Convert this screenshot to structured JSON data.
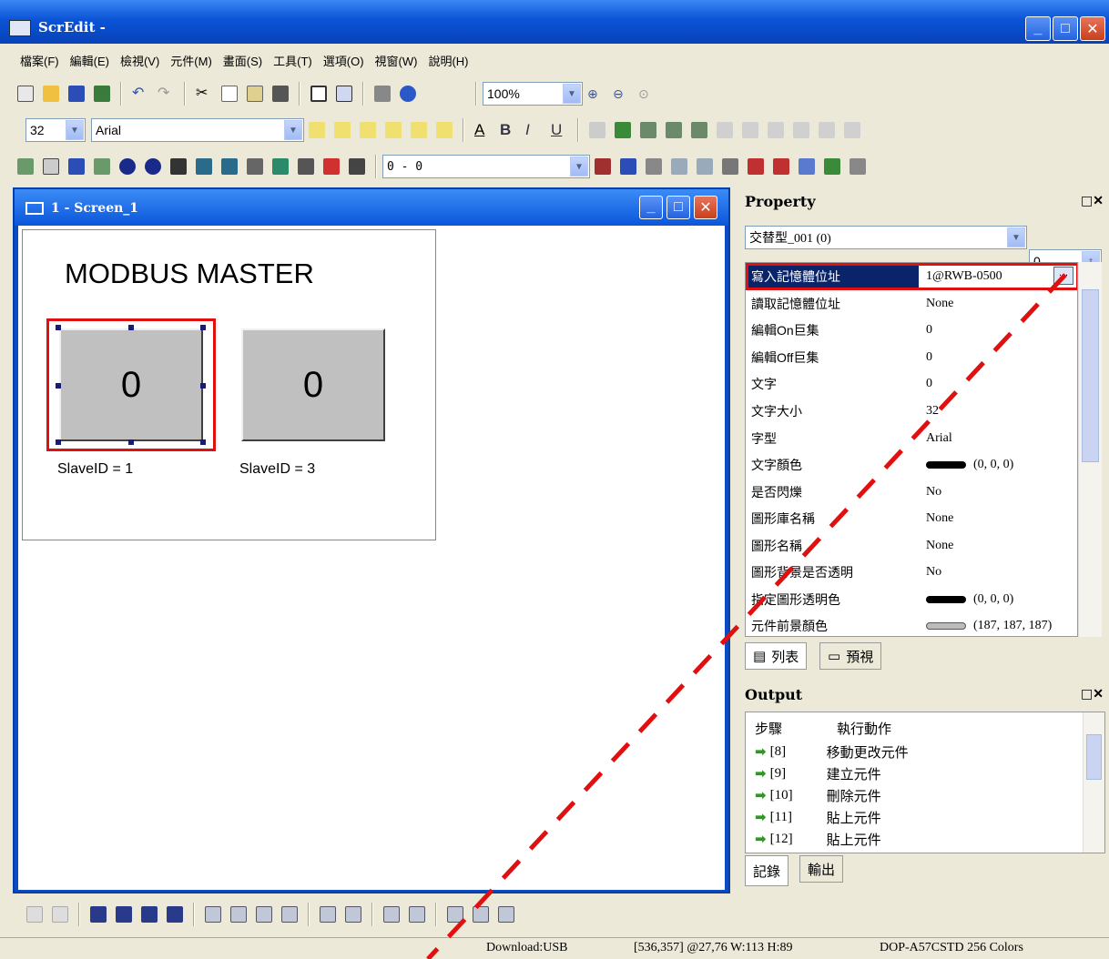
{
  "window": {
    "title": "ScrEdit -"
  },
  "menu": [
    "檔案(F)",
    "編輯(E)",
    "檢視(V)",
    "元件(M)",
    "畫面(S)",
    "工具(T)",
    "選項(O)",
    "視窗(W)",
    "說明(H)"
  ],
  "toolbar": {
    "zoom": "100%",
    "font_size": "32",
    "font_name": "Arial",
    "state_combo": "0 - 0"
  },
  "screen": {
    "window_title": "1 - Screen_1",
    "heading": "MODBUS MASTER",
    "buttons": [
      {
        "text": "0",
        "label": "SlaveID = 1"
      },
      {
        "text": "0",
        "label": "SlaveID = 3"
      }
    ]
  },
  "property": {
    "title": "Property",
    "object": "交替型_001 (0)",
    "state": "0",
    "rows": [
      {
        "key": "寫入記憶體位址",
        "value": "1@RWB-0500"
      },
      {
        "key": "讀取記憶體位址",
        "value": "None"
      },
      {
        "key": "編輯On巨集",
        "value": "0"
      },
      {
        "key": "編輯Off巨集",
        "value": "0"
      },
      {
        "key": "文字",
        "value": "0"
      },
      {
        "key": "文字大小",
        "value": "32"
      },
      {
        "key": "字型",
        "value": "Arial"
      },
      {
        "key": "文字顏色",
        "value": "(0, 0, 0)"
      },
      {
        "key": "是否閃爍",
        "value": "No"
      },
      {
        "key": "圖形庫名稱",
        "value": "None"
      },
      {
        "key": "圖形名稱",
        "value": "None"
      },
      {
        "key": "圖形背景是否透明",
        "value": "No"
      },
      {
        "key": "指定圖形透明色",
        "value": "(0, 0, 0)"
      },
      {
        "key": "元件前景顏色",
        "value": "(187, 187, 187)"
      }
    ],
    "tabs": [
      "列表",
      "預視"
    ]
  },
  "output": {
    "title": "Output",
    "headers": [
      "步驟",
      "執行動作"
    ],
    "rows": [
      {
        "step": "[8]",
        "action": "移動更改元件"
      },
      {
        "step": "[9]",
        "action": "建立元件"
      },
      {
        "step": "[10]",
        "action": "刪除元件"
      },
      {
        "step": "[11]",
        "action": "貼上元件"
      },
      {
        "step": "[12]",
        "action": "貼上元件"
      }
    ],
    "tabs": [
      "記錄",
      "輸出"
    ]
  },
  "status": {
    "download": "Download:USB",
    "coords": "[536,357] @27,76 W:113 H:89",
    "model": "DOP-A57CSTD 256 Colors"
  },
  "colors": {
    "title_blue": "#0a53d6",
    "highlight_red": "#e01010",
    "selection_blue": "#0a246a",
    "swatch_black": "#000000",
    "swatch_gray": "#bbbbbb"
  }
}
